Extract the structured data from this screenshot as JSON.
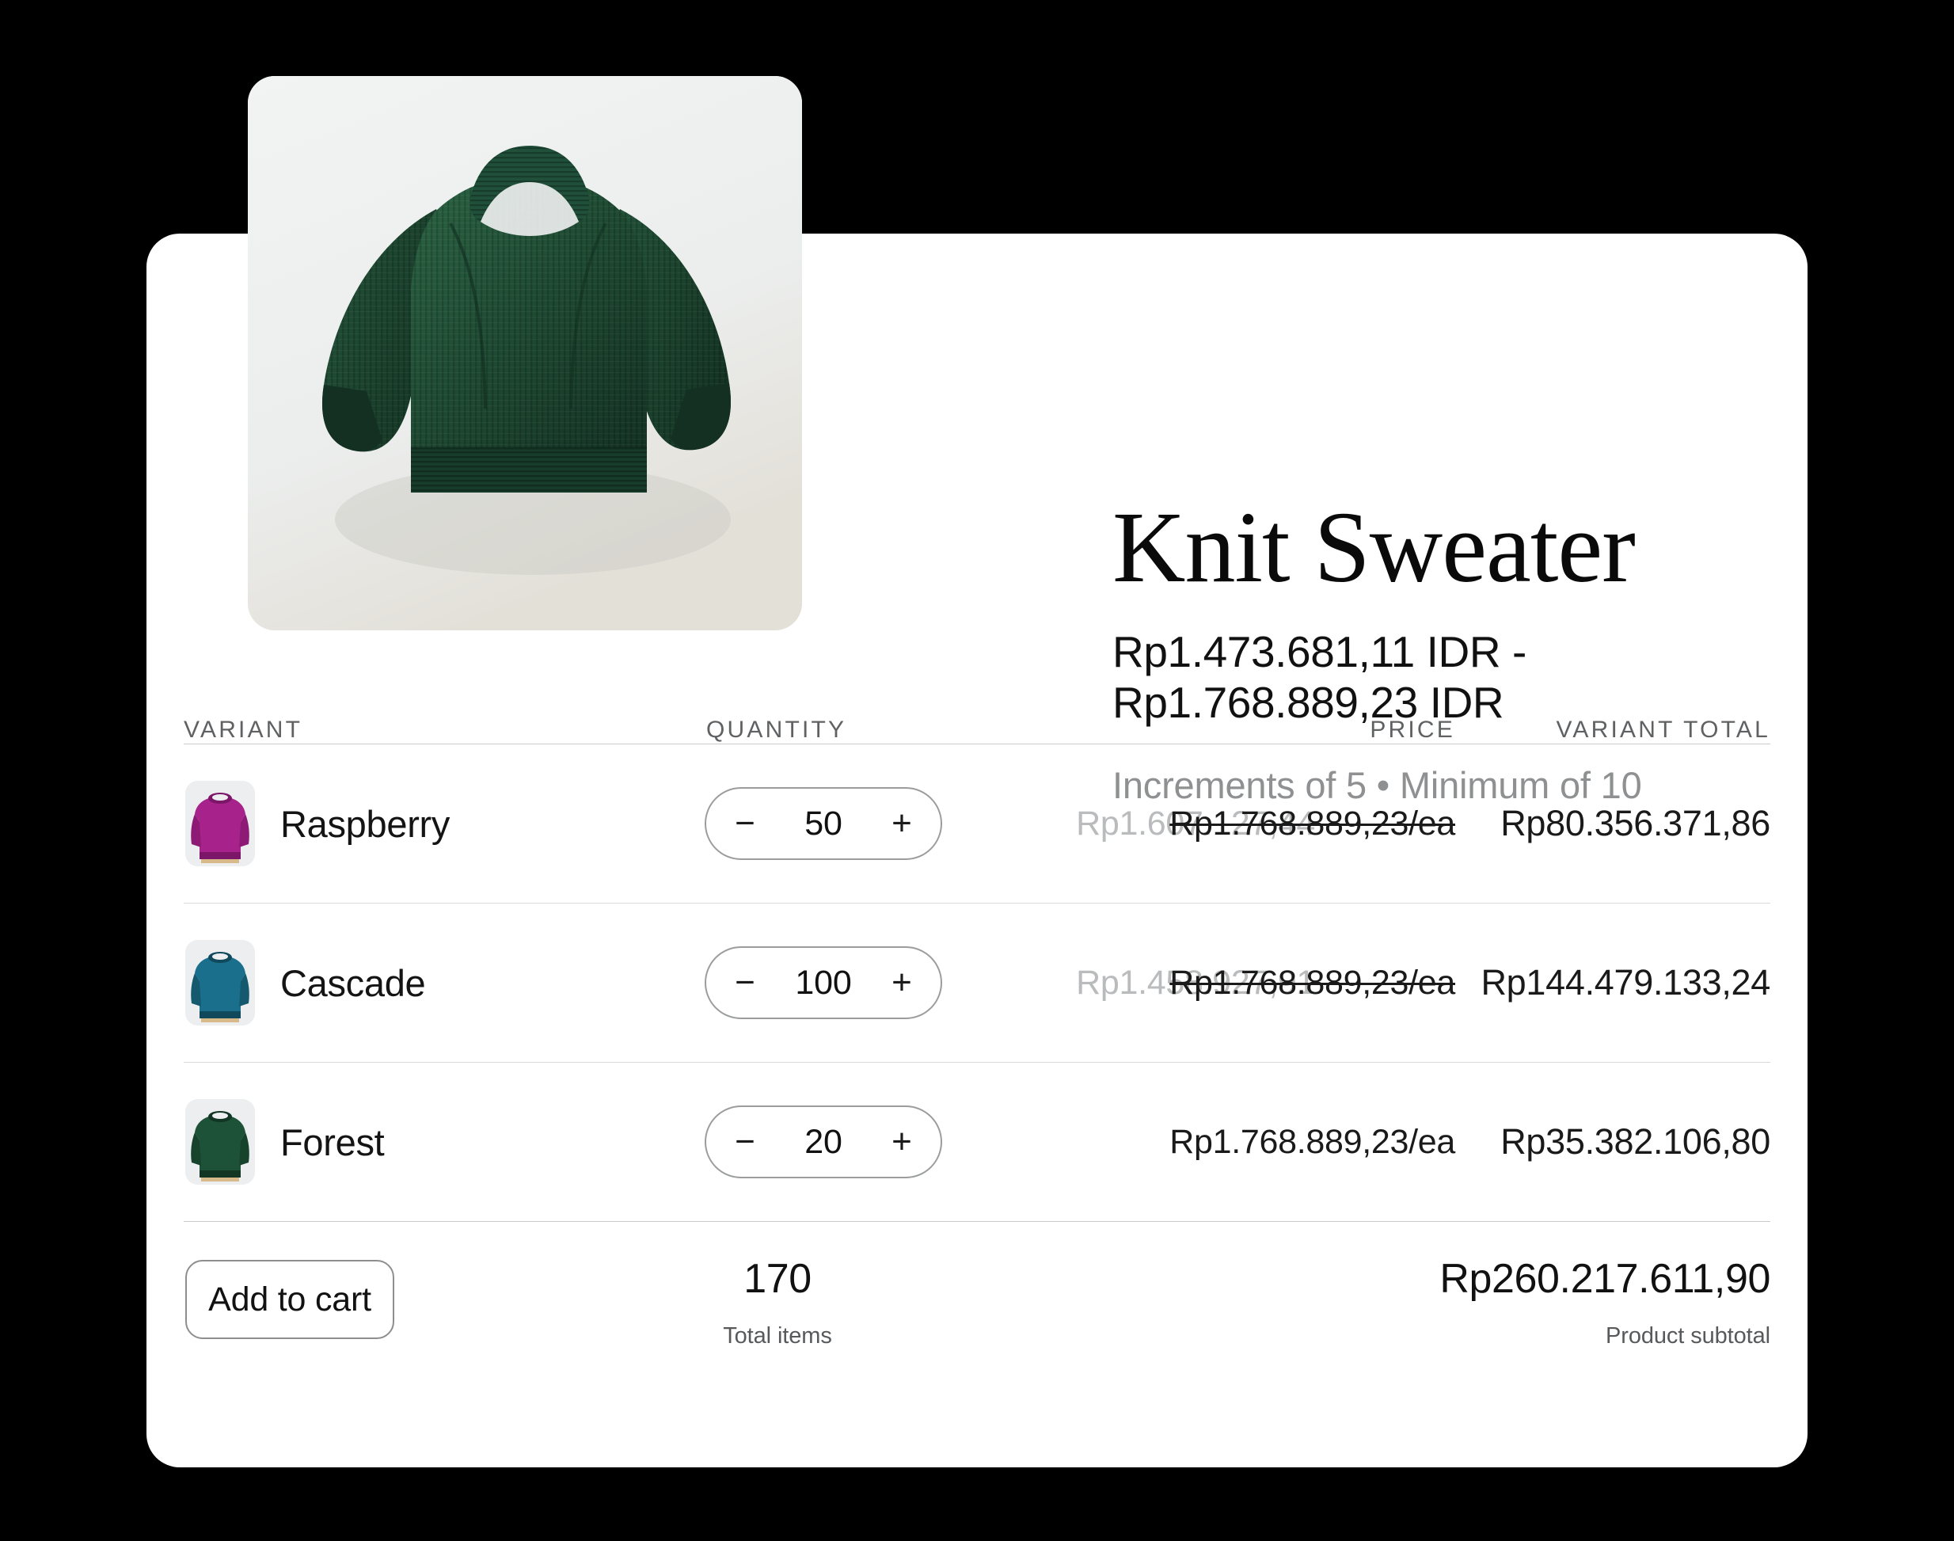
{
  "product": {
    "title": "Knit Sweater",
    "price_range": "Rp1.473.681,11 IDR - Rp1.768.889,23 IDR",
    "price_range_line1": "Rp1.473.681,11 IDR -",
    "price_range_line2": "Rp1.768.889,23 IDR",
    "purchase_terms": "Increments of 5 • Minimum of 10",
    "hero_image_alt": "green-knit-sweater-photo"
  },
  "table": {
    "headers": {
      "variant": "VARIANT",
      "quantity": "QUANTITY",
      "price": "PRICE",
      "variant_total": "VARIANT TOTAL"
    },
    "rows": [
      {
        "name": "Raspberry",
        "swatch": "raspberry-sweater-thumbnail",
        "swatch_color": "#a8228c",
        "quantity": "50",
        "decrement_label": "−",
        "increment_label": "+",
        "discounted_price": "Rp1.607.127,44",
        "unit_price": "Rp1.768.889,23/ea",
        "unit_price_struck": true,
        "variant_total": "Rp80.356.371,86"
      },
      {
        "name": "Cascade",
        "swatch": "cascade-sweater-thumbnail",
        "swatch_color": "#1a6f8c",
        "quantity": "100",
        "decrement_label": "−",
        "increment_label": "+",
        "discounted_price": "Rp1.458.927,91",
        "unit_price": "Rp1.768.889,23/ea",
        "unit_price_struck": true,
        "variant_total": "Rp144.479.133,24"
      },
      {
        "name": "Forest",
        "swatch": "forest-sweater-thumbnail",
        "swatch_color": "#1d5238",
        "quantity": "20",
        "decrement_label": "−",
        "increment_label": "+",
        "discounted_price": "",
        "unit_price": "Rp1.768.889,23/ea",
        "unit_price_struck": false,
        "variant_total": "Rp35.382.106,80"
      }
    ]
  },
  "footer": {
    "add_to_cart_label": "Add to cart",
    "total_items_value": "170",
    "total_items_caption": "Total items",
    "subtotal_value": "Rp260.217.611,90",
    "subtotal_caption": "Product subtotal"
  },
  "colors": {
    "page_background": "#000000",
    "card_background": "#ffffff",
    "muted_text": "#8f9091",
    "strikethrough_text": "#1a1a1a",
    "faded_price": "#b9bbbc",
    "border": "#9a9c9e",
    "rule": "#d8d9da"
  }
}
